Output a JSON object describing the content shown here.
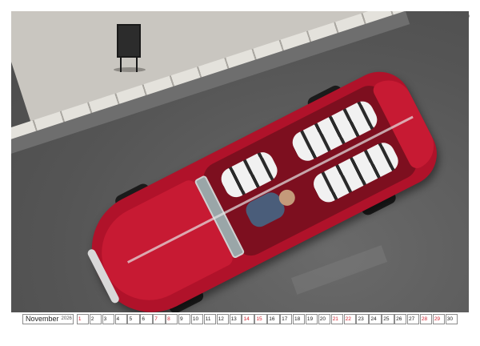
{
  "photo": {
    "description_icon": "classic-red-convertible-photo"
  },
  "calendar": {
    "month": "November",
    "year": "2026",
    "days": [
      {
        "label": "1",
        "red": true
      },
      {
        "label": "2",
        "red": false
      },
      {
        "label": "3",
        "red": false
      },
      {
        "label": "4",
        "red": false
      },
      {
        "label": "5",
        "red": false
      },
      {
        "label": "6",
        "red": false
      },
      {
        "label": "7",
        "red": true
      },
      {
        "label": "8",
        "red": true
      },
      {
        "label": "9",
        "red": false
      },
      {
        "label": "10",
        "red": false
      },
      {
        "label": "11",
        "red": false
      },
      {
        "label": "12",
        "red": false
      },
      {
        "label": "13",
        "red": false
      },
      {
        "label": "14",
        "red": true
      },
      {
        "label": "15",
        "red": true
      },
      {
        "label": "16",
        "red": false
      },
      {
        "label": "17",
        "red": false
      },
      {
        "label": "18",
        "red": false
      },
      {
        "label": "19",
        "red": false
      },
      {
        "label": "20",
        "red": false
      },
      {
        "label": "21",
        "red": true
      },
      {
        "label": "22",
        "red": true
      },
      {
        "label": "23",
        "red": false
      },
      {
        "label": "24",
        "red": false
      },
      {
        "label": "25",
        "red": false
      },
      {
        "label": "26",
        "red": false
      },
      {
        "label": "27",
        "red": false
      },
      {
        "label": "28",
        "red": true
      },
      {
        "label": "29",
        "red": true
      },
      {
        "label": "30",
        "red": false
      }
    ],
    "weekend_color": "#d0202e",
    "weekday_color": "#222222"
  }
}
